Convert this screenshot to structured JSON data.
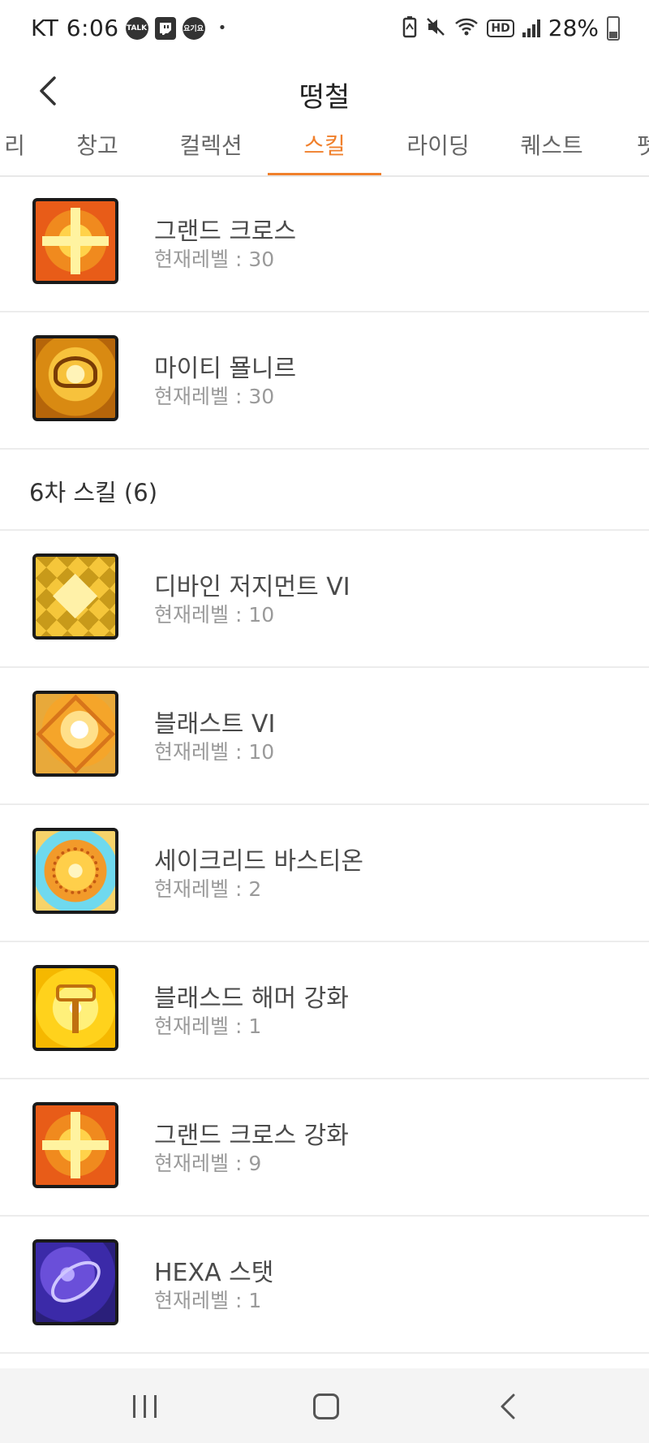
{
  "status_bar": {
    "carrier_time": "KT 6:06",
    "notification_icons": [
      "talk-icon",
      "twitch-icon",
      "yogiyo-icon"
    ],
    "talk_icon_text": "TALK",
    "yogiyo_icon_text": "요기요",
    "dot": "•",
    "system_icons": [
      "battery-saver-icon",
      "mute-icon",
      "wifi-icon",
      "hd-icon",
      "signal-icon"
    ],
    "hd_label": "HD",
    "battery_percent": "28%"
  },
  "header": {
    "title": "떵철"
  },
  "tabs": [
    {
      "label": "리",
      "active": false
    },
    {
      "label": "창고",
      "active": false
    },
    {
      "label": "컬렉션",
      "active": false
    },
    {
      "label": "스킬",
      "active": true
    },
    {
      "label": "라이딩",
      "active": false
    },
    {
      "label": "퀘스트",
      "active": false
    },
    {
      "label": "펫",
      "active": false
    }
  ],
  "accent_color": "#f0802c",
  "skills_top": [
    {
      "name": "그랜드 크로스",
      "level": "현재레벨 : 30",
      "icon": "grand-cross-icon"
    },
    {
      "name": "마이티 묠니르",
      "level": "현재레벨 : 30",
      "icon": "mighty-mjolnir-icon"
    }
  ],
  "section": {
    "title": "6차 스킬 (6)"
  },
  "skills_sixth": [
    {
      "name": "디바인 저지먼트 VI",
      "level": "현재레벨 : 10",
      "icon": "divine-judgement-icon"
    },
    {
      "name": "블래스트 VI",
      "level": "현재레벨 : 10",
      "icon": "blast-icon"
    },
    {
      "name": "세이크리드 바스티온",
      "level": "현재레벨 : 2",
      "icon": "sacred-bastion-icon"
    },
    {
      "name": "블래스드 해머 강화",
      "level": "현재레벨 : 1",
      "icon": "blessed-hammer-icon"
    },
    {
      "name": "그랜드 크로스 강화",
      "level": "현재레벨 : 9",
      "icon": "grand-cross-enhance-icon"
    },
    {
      "name": "HEXA 스탯",
      "level": "현재레벨 : 1",
      "icon": "hexa-stat-icon"
    }
  ],
  "nav_bar": {
    "buttons": [
      "recent-apps-icon",
      "home-icon",
      "back-icon"
    ]
  }
}
